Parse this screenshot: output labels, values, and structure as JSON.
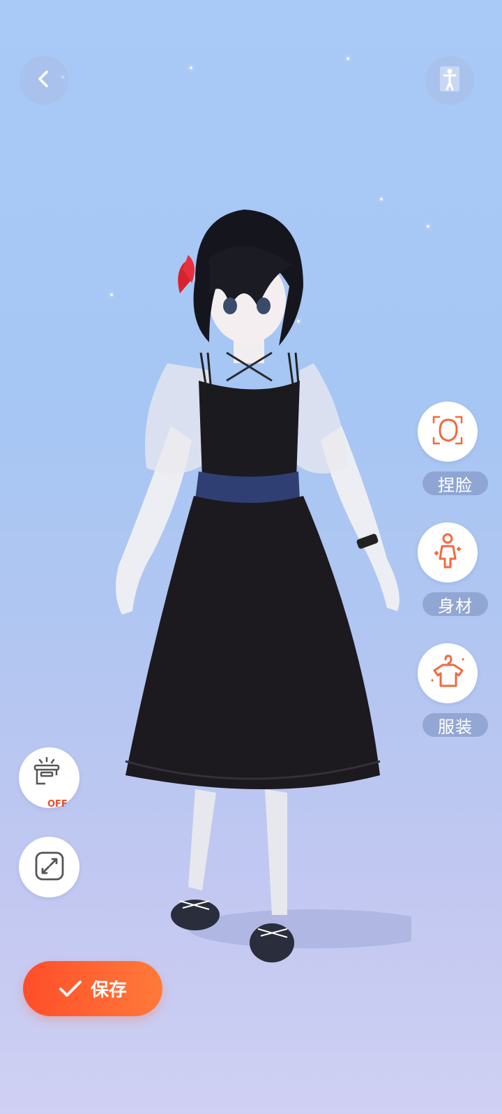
{
  "nav": {
    "back_icon": "chevron-left-icon",
    "body_view_icon": "person-standing-icon"
  },
  "side_menu": {
    "items": [
      {
        "label": "捏脸",
        "icon": "face-outline-icon"
      },
      {
        "label": "身材",
        "icon": "body-shape-icon"
      },
      {
        "label": "服装",
        "icon": "clothes-hanger-icon"
      }
    ]
  },
  "tools": {
    "background_toggle": {
      "state_text": "OFF",
      "icon": "backdrop-lamp-icon"
    },
    "fullscreen_icon": "expand-arrows-icon"
  },
  "save": {
    "label": "保存",
    "icon": "checkmark-icon"
  },
  "colors": {
    "accent_orange": "#ff6a36",
    "icon_orange": "#f06a3f",
    "background_top": "#a9c9f7",
    "background_bottom": "#cfd0f3"
  },
  "avatar": {
    "hair": "#15161d",
    "dress": "#1c1a1f",
    "belt": "#2f3f73",
    "ribbon": "#d8232f"
  }
}
